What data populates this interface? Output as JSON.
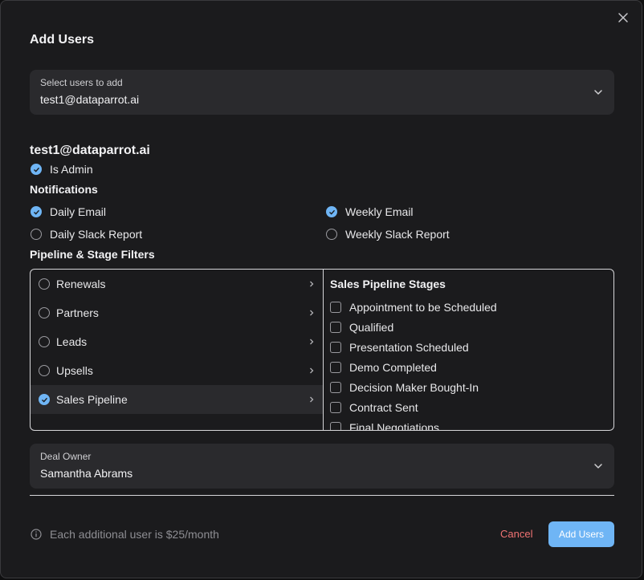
{
  "modal": {
    "title": "Add Users",
    "close_icon": "close-icon"
  },
  "select_users": {
    "label": "Select users to add",
    "value": "test1@dataparrot.ai"
  },
  "user": {
    "email": "test1@dataparrot.ai",
    "is_admin_label": "Is Admin",
    "is_admin": true
  },
  "notifications": {
    "title": "Notifications",
    "daily_email": {
      "label": "Daily Email",
      "checked": true
    },
    "weekly_email": {
      "label": "Weekly Email",
      "checked": true
    },
    "daily_slack": {
      "label": "Daily Slack Report",
      "checked": false
    },
    "weekly_slack": {
      "label": "Weekly Slack Report",
      "checked": false
    }
  },
  "filters": {
    "title": "Pipeline & Stage Filters",
    "pipelines": [
      {
        "label": "Renewals",
        "checked": false
      },
      {
        "label": "Partners",
        "checked": false
      },
      {
        "label": "Leads",
        "checked": false
      },
      {
        "label": "Upsells",
        "checked": false
      },
      {
        "label": "Sales Pipeline",
        "checked": true
      }
    ],
    "stages_title": "Sales Pipeline Stages",
    "stages": [
      {
        "label": "Appointment to be Scheduled",
        "checked": false
      },
      {
        "label": "Qualified",
        "checked": false
      },
      {
        "label": "Presentation Scheduled",
        "checked": false
      },
      {
        "label": "Demo Completed",
        "checked": false
      },
      {
        "label": "Decision Maker Bought-In",
        "checked": false
      },
      {
        "label": "Contract Sent",
        "checked": false
      },
      {
        "label": "Final Negotiations",
        "checked": false
      }
    ]
  },
  "deal_owner": {
    "label": "Deal Owner",
    "value": "Samantha Abrams"
  },
  "footer": {
    "note": "Each additional user is $25/month",
    "cancel": "Cancel",
    "add": "Add Users"
  },
  "colors": {
    "accent": "#6fb5f5",
    "danger": "#f07373",
    "background": "#1b1b1d"
  }
}
